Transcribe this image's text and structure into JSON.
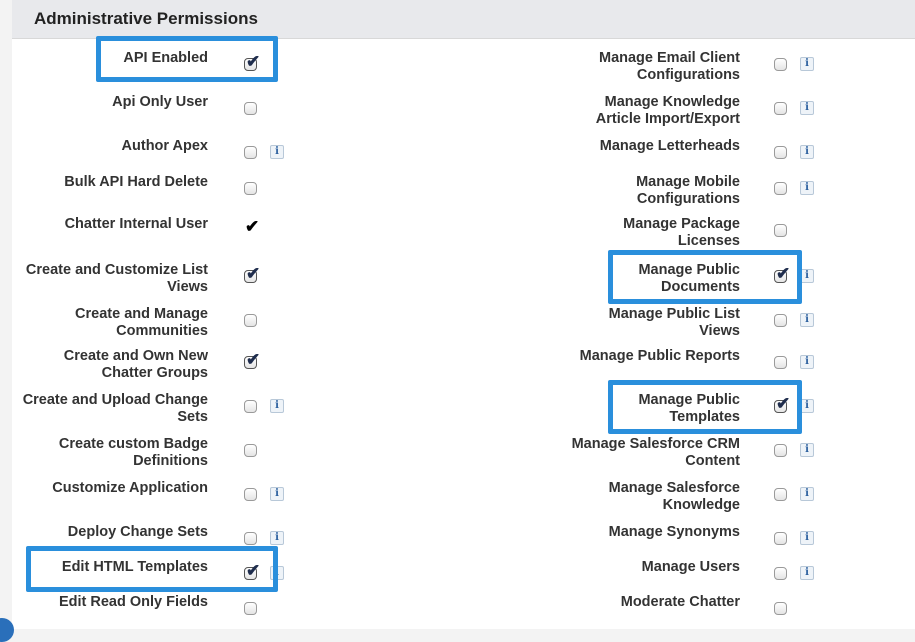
{
  "section": {
    "title": "Administrative Permissions"
  },
  "left_column": [
    {
      "label": "API Enabled",
      "checked": true,
      "info": false
    },
    {
      "label": "Api Only User",
      "checked": false,
      "info": false
    },
    {
      "label": "Author Apex",
      "checked": false,
      "info": true
    },
    {
      "label": "Bulk API Hard Delete",
      "checked": false,
      "info": false
    },
    {
      "label": "Chatter Internal User",
      "checked": true,
      "info": false,
      "plain": true
    },
    {
      "label": "Create and Customize List Views",
      "checked": true,
      "info": false
    },
    {
      "label": "Create and Manage Communities",
      "checked": false,
      "info": false
    },
    {
      "label": "Create and Own New Chatter Groups",
      "checked": true,
      "info": false
    },
    {
      "label": "Create and Upload Change Sets",
      "checked": false,
      "info": true
    },
    {
      "label": "Create custom Badge Definitions",
      "checked": false,
      "info": false
    },
    {
      "label": "Customize Application",
      "checked": false,
      "info": true
    },
    {
      "label": "Deploy Change Sets",
      "checked": false,
      "info": true
    },
    {
      "label": "Edit HTML Templates",
      "checked": true,
      "info": true
    },
    {
      "label": "Edit Read Only Fields",
      "checked": false,
      "info": false
    }
  ],
  "right_column": [
    {
      "label": "Manage Email Client Configurations",
      "checked": false,
      "info": true
    },
    {
      "label": "Manage Knowledge Article Import/Export",
      "checked": false,
      "info": true
    },
    {
      "label": "Manage Letterheads",
      "checked": false,
      "info": true
    },
    {
      "label": "Manage Mobile Configurations",
      "checked": false,
      "info": true
    },
    {
      "label": "Manage Package Licenses",
      "checked": false,
      "info": false
    },
    {
      "label": "Manage Public Documents",
      "checked": true,
      "info": true
    },
    {
      "label": "Manage Public List Views",
      "checked": false,
      "info": true
    },
    {
      "label": "Manage Public Reports",
      "checked": false,
      "info": true
    },
    {
      "label": "Manage Public Templates",
      "checked": true,
      "info": true
    },
    {
      "label": "Manage Salesforce CRM Content",
      "checked": false,
      "info": true
    },
    {
      "label": "Manage Salesforce Knowledge",
      "checked": false,
      "info": true
    },
    {
      "label": "Manage Synonyms",
      "checked": false,
      "info": true
    },
    {
      "label": "Manage Users",
      "checked": false,
      "info": true
    },
    {
      "label": "Moderate Chatter",
      "checked": false,
      "info": false
    }
  ],
  "icons": {
    "checkmark": "checkmark-icon",
    "info": "info-icon"
  },
  "colors": {
    "highlight": "#2a8fdc",
    "header_bg": "#e8e9ec",
    "checkmark": "#1f2d4d"
  }
}
